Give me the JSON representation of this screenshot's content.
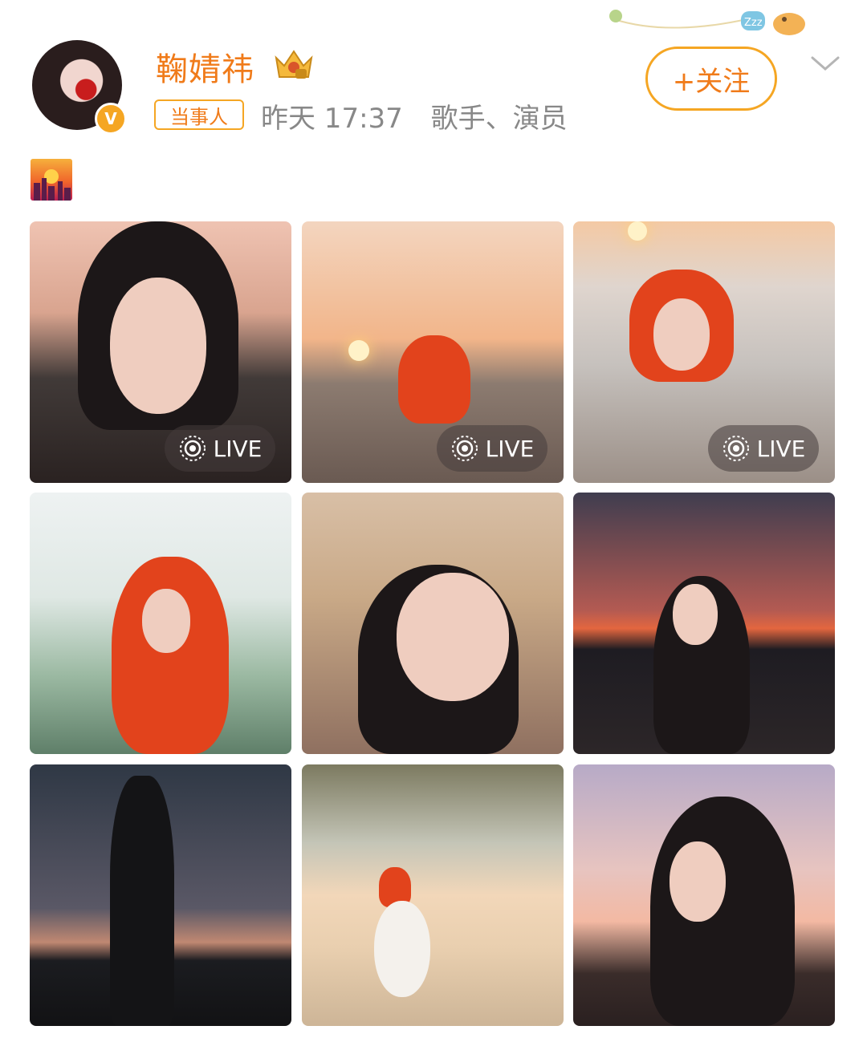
{
  "header": {
    "username": "鞠婧祎",
    "party_tag": "当事人",
    "timestamp": "昨天 17:37",
    "occupation": "歌手、演员",
    "follow_label": "+关注",
    "decor_text": "Zzz"
  },
  "post": {
    "photos": [
      {
        "live": true,
        "live_label": "LIVE"
      },
      {
        "live": true,
        "live_label": "LIVE"
      },
      {
        "live": true,
        "live_label": "LIVE"
      },
      {
        "live": false
      },
      {
        "live": false
      },
      {
        "live": false
      },
      {
        "live": false
      },
      {
        "live": false
      },
      {
        "live": false
      }
    ]
  },
  "colors": {
    "accent": "#f07b1a",
    "badge": "#f5a623",
    "meta_text": "#888888"
  },
  "icons": [
    "verified-badge-icon",
    "crown-badge-icon",
    "chevron-down-icon",
    "live-photo-icon",
    "sunset-emoji-icon"
  ]
}
